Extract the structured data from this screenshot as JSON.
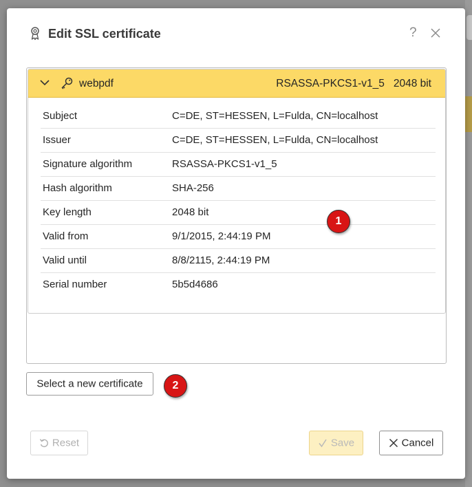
{
  "dialog": {
    "title": "Edit SSL certificate",
    "help": "?"
  },
  "certificate": {
    "name": "webpdf",
    "algorithm": "RSASSA-PKCS1-v1_5",
    "key_size": "2048 bit",
    "fields": [
      {
        "label": "Subject",
        "value": "C=DE, ST=HESSEN, L=Fulda, CN=localhost"
      },
      {
        "label": "Issuer",
        "value": "C=DE, ST=HESSEN, L=Fulda, CN=localhost"
      },
      {
        "label": "Signature algorithm",
        "value": "RSASSA-PKCS1-v1_5"
      },
      {
        "label": "Hash algorithm",
        "value": "SHA-256"
      },
      {
        "label": "Key length",
        "value": "2048 bit"
      },
      {
        "label": "Valid from",
        "value": "9/1/2015, 2:44:19 PM"
      },
      {
        "label": "Valid until",
        "value": "8/8/2115, 2:44:19 PM"
      },
      {
        "label": "Serial number",
        "value": "5b5d4686"
      }
    ]
  },
  "callouts": {
    "one": "1",
    "two": "2"
  },
  "buttons": {
    "select": "Select a new certificate",
    "reset": "Reset",
    "save": "Save",
    "cancel": "Cancel"
  },
  "colors": {
    "header_accent": "#fcd966",
    "callout": "#d81515",
    "save_disabled_bg": "#fdf0c2"
  }
}
